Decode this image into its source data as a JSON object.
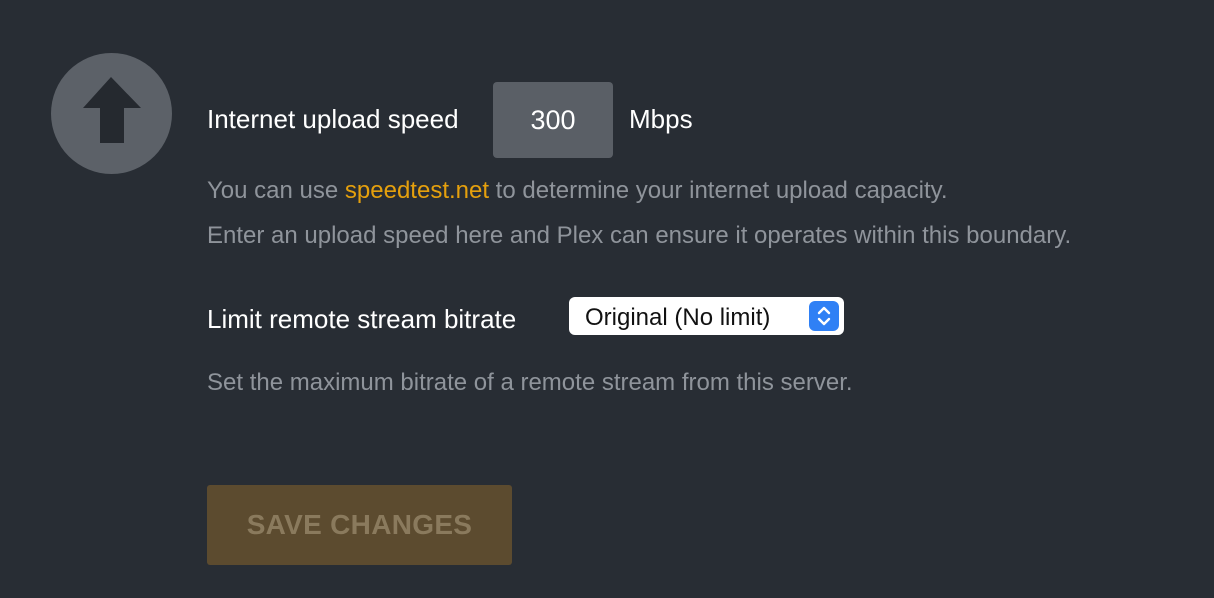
{
  "upload_speed": {
    "label": "Internet upload speed",
    "value": "300",
    "unit": "Mbps",
    "help_prefix": "You can use ",
    "help_link": "speedtest.net",
    "help_suffix": " to determine your internet upload capacity.",
    "help_line2": "Enter an upload speed here and Plex can ensure it operates within this boundary."
  },
  "bitrate": {
    "label": "Limit remote stream bitrate",
    "selected": "Original (No limit)",
    "help": "Set the maximum bitrate of a remote stream from this server."
  },
  "save_label": "SAVE CHANGES",
  "icons": {
    "section": "upload-arrow-icon",
    "select": "select-stepper-icon"
  },
  "colors": {
    "background": "#282d34",
    "link": "#e5a00d",
    "button_bg": "#5c4b2f",
    "select_accent": "#2f80f5"
  }
}
